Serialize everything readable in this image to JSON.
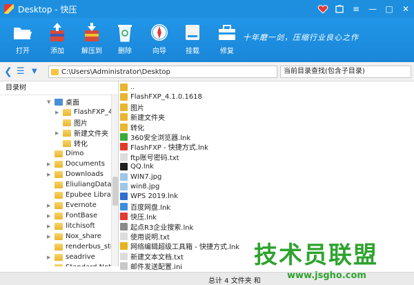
{
  "window": {
    "title": "Desktop - 快压",
    "controls": [
      "heart-icon",
      "skin-icon",
      "menu-icon",
      "minimize-icon",
      "maximize-icon",
      "close-icon"
    ]
  },
  "toolbar": {
    "buttons": [
      {
        "label": "打开",
        "icon": "open-folder-icon"
      },
      {
        "label": "添加",
        "icon": "add-archive-icon"
      },
      {
        "label": "解压到",
        "icon": "extract-to-icon"
      },
      {
        "label": "删除",
        "icon": "recycle-bin-icon"
      },
      {
        "label": "向导",
        "icon": "compass-icon"
      },
      {
        "label": "挂载",
        "icon": "disk-mount-icon"
      },
      {
        "label": "修复",
        "icon": "toolbox-icon"
      }
    ],
    "slogan": "十年磨一剑，压缩行业良心之作"
  },
  "address": {
    "path": "C:\\Users\\Administrator\\Desktop",
    "search_placeholder": "当前目录查找(包含子目录)"
  },
  "tree": {
    "header": "目录树",
    "items": [
      {
        "label": "桌面",
        "indent": 1,
        "icon": "desktop-folder-icon",
        "expand": "▼"
      },
      {
        "label": "FlashFXP_4.1",
        "indent": 2,
        "icon": "folder-icon",
        "expand": "▶"
      },
      {
        "label": "图片",
        "indent": 2,
        "icon": "folder-icon",
        "expand": ""
      },
      {
        "label": "新建文件夹",
        "indent": 2,
        "icon": "folder-icon",
        "expand": "▶"
      },
      {
        "label": "转化",
        "indent": 2,
        "icon": "folder-icon",
        "expand": ""
      },
      {
        "label": "Dimo",
        "indent": 0,
        "icon": "folder-icon",
        "expand": ""
      },
      {
        "label": "Documents",
        "indent": 0,
        "icon": "folder-icon",
        "expand": "▶"
      },
      {
        "label": "Downloads",
        "indent": 0,
        "icon": "folder-icon",
        "expand": "▶"
      },
      {
        "label": "EliuliangData",
        "indent": 0,
        "icon": "folder-icon",
        "expand": ""
      },
      {
        "label": "Epubee Library",
        "indent": 0,
        "icon": "folder-icon",
        "expand": ""
      },
      {
        "label": "Evernote",
        "indent": 0,
        "icon": "folder-icon",
        "expand": "▶"
      },
      {
        "label": "FontBase",
        "indent": 0,
        "icon": "folder-icon",
        "expand": "▶"
      },
      {
        "label": "litchisoft",
        "indent": 0,
        "icon": "folder-icon",
        "expand": "▶"
      },
      {
        "label": "Nox_share",
        "indent": 0,
        "icon": "folder-icon",
        "expand": "▶"
      },
      {
        "label": "renderbus_stora",
        "indent": 0,
        "icon": "folder-icon",
        "expand": ""
      },
      {
        "label": "seadrive",
        "indent": 0,
        "icon": "folder-icon",
        "expand": "▶"
      },
      {
        "label": "Standard Notes",
        "indent": 0,
        "icon": "folder-icon",
        "expand": "▶"
      }
    ]
  },
  "files": [
    {
      "name": "..",
      "icon": "folder-icon",
      "color": "#e9b630"
    },
    {
      "name": "FlashFXP_4.1.0.1618",
      "icon": "folder-icon",
      "color": "#e9b630"
    },
    {
      "name": "图片",
      "icon": "folder-icon",
      "color": "#e9b630"
    },
    {
      "name": "新建文件夹",
      "icon": "folder-icon",
      "color": "#e9b630"
    },
    {
      "name": "转化",
      "icon": "folder-icon",
      "color": "#e9b630"
    },
    {
      "name": "360安全浏览器.lnk",
      "icon": "browser-360-icon",
      "color": "#3cab3c"
    },
    {
      "name": "FlashFXP - 快捷方式.lnk",
      "icon": "flashfxp-icon",
      "color": "#e03b2a"
    },
    {
      "name": "ftp账号密码.txt",
      "icon": "text-file-icon",
      "color": "#dcdcdc"
    },
    {
      "name": "QQ.lnk",
      "icon": "qq-icon",
      "color": "#222222"
    },
    {
      "name": "WIN7.jpg",
      "icon": "image-file-icon",
      "color": "#9ec7e8"
    },
    {
      "name": "win8.jpg",
      "icon": "image-file-icon",
      "color": "#9ec7e8"
    },
    {
      "name": "WPS 2019.lnk",
      "icon": "wps-icon",
      "color": "#2f6fd1"
    },
    {
      "name": "百度网盘.lnk",
      "icon": "baidu-netdisk-icon",
      "color": "#3c8de0"
    },
    {
      "name": "快压.lnk",
      "icon": "kuaiya-icon",
      "color": "#e53935"
    },
    {
      "name": "起点R3企业搜索.lnk",
      "icon": "search-app-icon",
      "color": "#8a8a8a"
    },
    {
      "name": "使用说明.txt",
      "icon": "text-file-icon",
      "color": "#dcdcdc"
    },
    {
      "name": "网络编辑超级工具箱 - 快捷方式.lnk",
      "icon": "toolbox-app-icon",
      "color": "#e6b422"
    },
    {
      "name": "新建文本文档.txt",
      "icon": "text-file-icon",
      "color": "#dcdcdc"
    },
    {
      "name": "邮件发送配置.ini",
      "icon": "config-file-icon",
      "color": "#c9c9c9"
    }
  ],
  "status": {
    "text": "总计 4 文件夹 和"
  },
  "watermark": {
    "text": "技术员联盟",
    "url": "www.jsgho.com"
  }
}
